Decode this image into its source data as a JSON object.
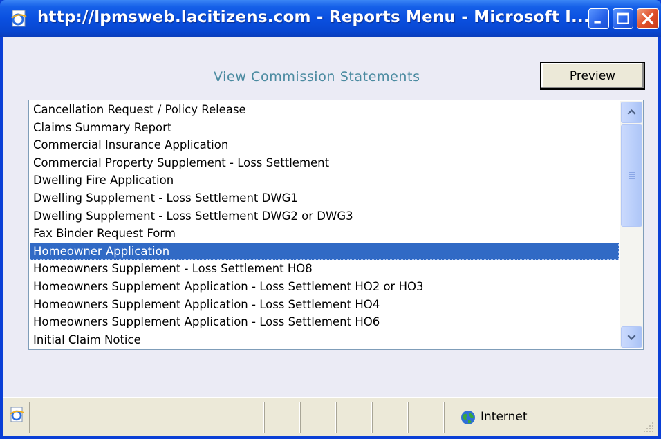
{
  "window": {
    "title": "http://lpmsweb.lacitizens.com - Reports Menu - Microsoft I...",
    "icon": "ie-page-icon",
    "controls": [
      "minimize-icon",
      "maximize-icon",
      "close-icon"
    ]
  },
  "header": {
    "view_link": "View Commission Statements",
    "preview_label": "Preview"
  },
  "report_list": {
    "items": [
      "Cancellation Request / Policy Release",
      "Claims Summary Report",
      "Commercial Insurance Application",
      "Commercial Property Supplement - Loss Settlement",
      "Dwelling Fire Application",
      "Dwelling Supplement - Loss Settlement DWG1",
      "Dwelling Supplement - Loss Settlement DWG2 or DWG3",
      "Fax Binder Request Form",
      "Homeowner Application",
      "Homeowners Supplement - Loss Settlement HO8",
      "Homeowners Supplement Application - Loss Settlement HO2 or HO3",
      "Homeowners Supplement Application - Loss Settlement HO4",
      "Homeowners Supplement Application - Loss Settlement HO6",
      "Initial Claim Notice"
    ],
    "selected_index": 8
  },
  "status_bar": {
    "page_icon": "ie-page-icon",
    "zone_icon": "globe-icon",
    "zone_text": "Internet"
  },
  "colors": {
    "titlebar": "#0a50e0",
    "selection": "#316ac5",
    "link": "#4a8aa0",
    "client_bg": "#ebebf5"
  }
}
